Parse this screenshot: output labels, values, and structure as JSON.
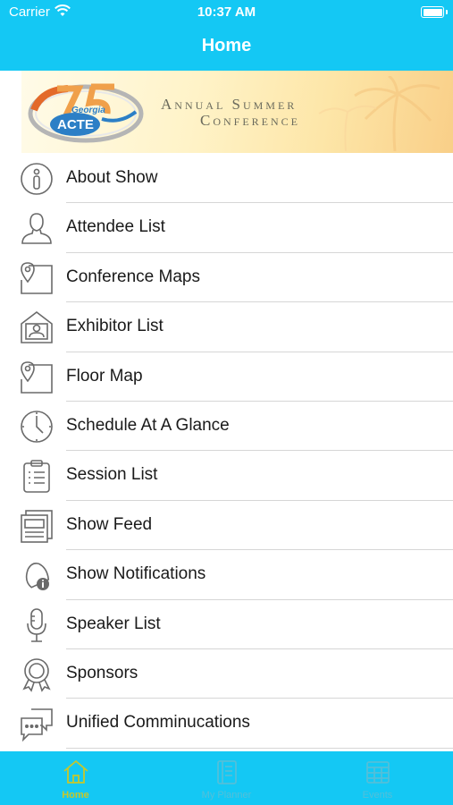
{
  "status_bar": {
    "carrier": "Carrier",
    "time": "10:37 AM"
  },
  "header": {
    "title": "Home"
  },
  "banner": {
    "logo_text": [
      "Georgia",
      "ACTE"
    ],
    "title_line1": "Annual Summer",
    "title_line2": "Conference"
  },
  "menu": {
    "items": [
      {
        "label": "About Show",
        "icon": "info-icon"
      },
      {
        "label": "Attendee List",
        "icon": "person-icon"
      },
      {
        "label": "Conference Maps",
        "icon": "map-pin-icon"
      },
      {
        "label": "Exhibitor List",
        "icon": "exhibitor-booth-icon"
      },
      {
        "label": "Floor Map",
        "icon": "map-pin-icon"
      },
      {
        "label": "Schedule At A Glance",
        "icon": "clock-icon"
      },
      {
        "label": "Session List",
        "icon": "clipboard-list-icon"
      },
      {
        "label": "Show Feed",
        "icon": "newspaper-icon"
      },
      {
        "label": "Show Notifications",
        "icon": "bell-info-icon"
      },
      {
        "label": "Speaker List",
        "icon": "microphone-icon"
      },
      {
        "label": "Sponsors",
        "icon": "award-ribbon-icon"
      },
      {
        "label": "Unified Comminucations",
        "icon": "chat-bubbles-icon"
      }
    ]
  },
  "tab_bar": {
    "tabs": [
      {
        "label": "Home",
        "icon": "home-icon",
        "active": true
      },
      {
        "label": "My Planner",
        "icon": "planner-icon",
        "active": false
      },
      {
        "label": "Events",
        "icon": "events-grid-icon",
        "active": false
      }
    ]
  },
  "colors": {
    "primary": "#14c8f4",
    "active_tab": "#c7c72a",
    "inactive_tab": "#53bfd9",
    "icon_gray": "#6a6a6a"
  }
}
